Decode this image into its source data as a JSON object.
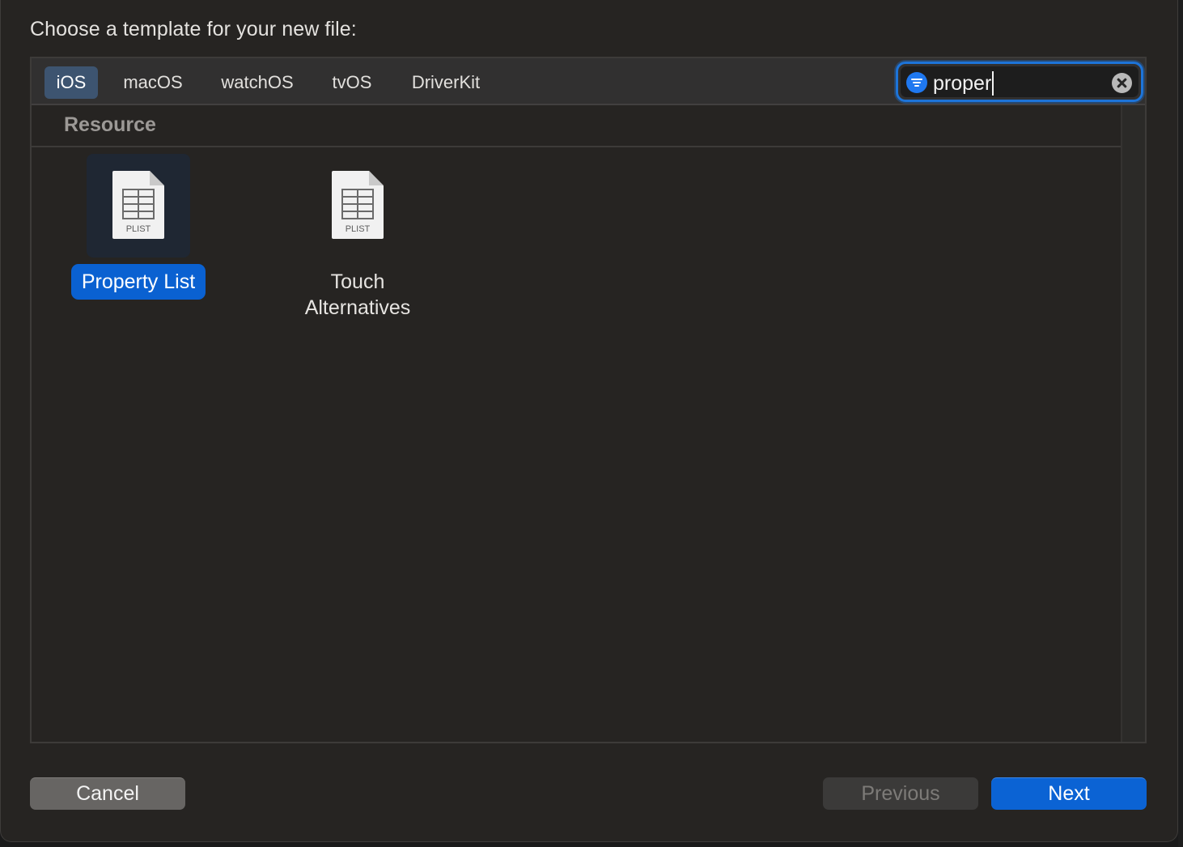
{
  "dialog": {
    "heading": "Choose a template for your new file:"
  },
  "platform_tabs": [
    {
      "label": "iOS",
      "selected": true
    },
    {
      "label": "macOS",
      "selected": false
    },
    {
      "label": "watchOS",
      "selected": false
    },
    {
      "label": "tvOS",
      "selected": false
    },
    {
      "label": "DriverKit",
      "selected": false
    }
  ],
  "filter": {
    "value": "proper",
    "icons": {
      "filter": "filter-icon",
      "clear": "clear-icon"
    }
  },
  "section": {
    "title": "Resource"
  },
  "templates": [
    {
      "name": "Property List",
      "icon_label": "PLIST",
      "icon": "plist-file-icon",
      "selected": true
    },
    {
      "name_line1": "Touch",
      "name_line2": "Alternatives",
      "icon_label": "PLIST",
      "icon": "plist-file-icon",
      "selected": false
    }
  ],
  "buttons": {
    "cancel": "Cancel",
    "previous": "Previous",
    "next": "Next"
  },
  "colors": {
    "accent": "#0b63d4",
    "selected_tab": "#3d5470",
    "focus_ring": "#1d74d9",
    "background": "#262422"
  }
}
